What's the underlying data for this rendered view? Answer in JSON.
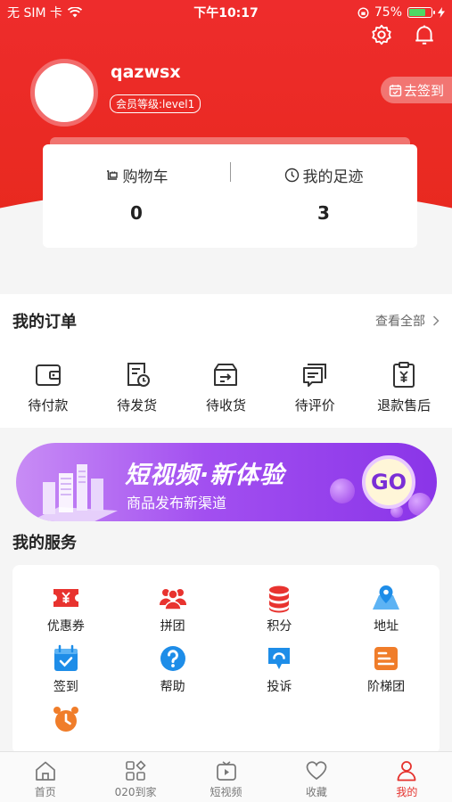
{
  "status_bar": {
    "carrier": "无 SIM 卡",
    "time": "下午10:17",
    "battery": "75%",
    "battery_level": 0.75
  },
  "profile": {
    "username": "qazwsx",
    "level": "会员等级:level1",
    "checkin_label": "去签到"
  },
  "stats": [
    {
      "label": "购物车",
      "value": "0",
      "icon": "cart-icon"
    },
    {
      "label": "我的足迹",
      "value": "3",
      "icon": "clock-icon"
    }
  ],
  "orders": {
    "title": "我的订单",
    "view_all": "查看全部",
    "items": [
      {
        "label": "待付款",
        "icon": "wallet-icon"
      },
      {
        "label": "待发货",
        "icon": "shipping-doc-icon"
      },
      {
        "label": "待收货",
        "icon": "box-icon"
      },
      {
        "label": "待评价",
        "icon": "comment-icon"
      },
      {
        "label": "退款售后",
        "icon": "refund-icon"
      }
    ]
  },
  "banner": {
    "title": "短视频·新体验",
    "subtitle": "商品发布新渠道",
    "go": "GO"
  },
  "services": {
    "title": "我的服务",
    "items": [
      {
        "label": "优惠券",
        "icon": "coupon-icon",
        "color": "#e8332f"
      },
      {
        "label": "拼团",
        "icon": "group-icon",
        "color": "#e8332f"
      },
      {
        "label": "积分",
        "icon": "points-icon",
        "color": "#e8332f"
      },
      {
        "label": "地址",
        "icon": "location-icon",
        "color": "#1e8de8"
      },
      {
        "label": "签到",
        "icon": "calendar-check-icon",
        "color": "#1e8de8"
      },
      {
        "label": "帮助",
        "icon": "help-icon",
        "color": "#1e8de8"
      },
      {
        "label": "投诉",
        "icon": "complaint-icon",
        "color": "#1e8de8"
      },
      {
        "label": "阶梯团",
        "icon": "ladder-icon",
        "color": "#f07d2a"
      },
      {
        "label": "",
        "icon": "alarm-icon",
        "color": "#f07d2a"
      }
    ]
  },
  "tabbar": [
    {
      "label": "首页",
      "icon": "home-icon",
      "active": false
    },
    {
      "label": "020到家",
      "icon": "grid-icon",
      "active": false
    },
    {
      "label": "短视频",
      "icon": "video-icon",
      "active": false
    },
    {
      "label": "收藏",
      "icon": "heart-icon",
      "active": false
    },
    {
      "label": "我的",
      "icon": "user-icon",
      "active": true
    }
  ],
  "colors": {
    "brand_red": "#e8291f",
    "active_tab": "#e5322d",
    "banner_purple": "#a24ff0"
  }
}
